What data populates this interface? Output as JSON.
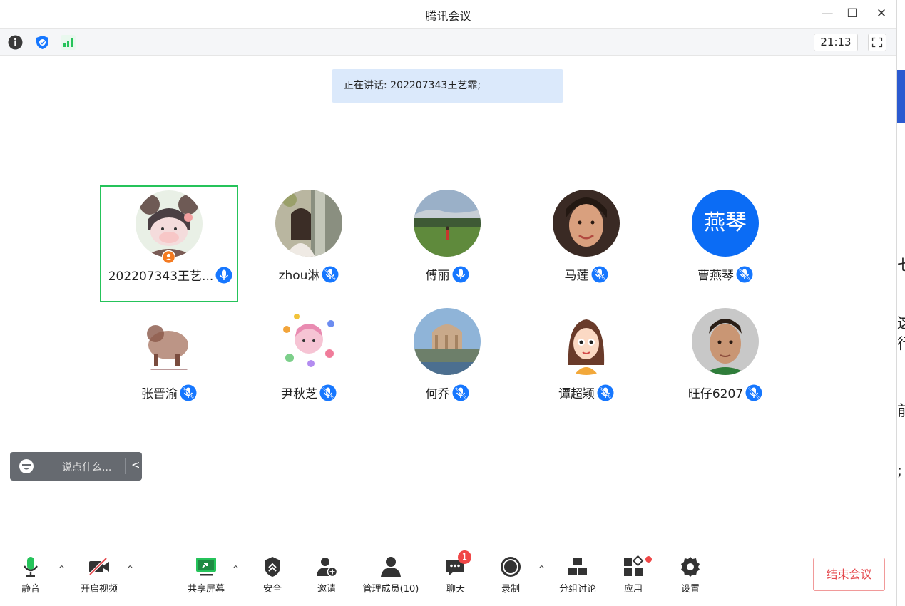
{
  "window": {
    "title": "腾讯会议",
    "minimize": "—",
    "maximize": "☐",
    "close": "✕"
  },
  "status_bar": {
    "clock": "21:13",
    "icons": [
      "info-icon",
      "shield-icon",
      "signal-icon",
      "fullscreen-icon"
    ]
  },
  "banner": {
    "speaking_label": "正在讲话: 202207343王艺霏;"
  },
  "participants": [
    {
      "name": "202207343王艺...",
      "avatar": "cartoon-avatar",
      "mic": "active",
      "host": true,
      "active_speaker": true
    },
    {
      "name": "zhou淋",
      "avatar": "photo-avatar",
      "mic": "muted"
    },
    {
      "name": "傅丽",
      "avatar": "photo-avatar",
      "mic": "active"
    },
    {
      "name": "马莲",
      "avatar": "photo-avatar",
      "mic": "muted"
    },
    {
      "name": "曹燕琴",
      "avatar": "text-avatar",
      "avatar_text": "燕琴",
      "mic": "muted"
    },
    {
      "name": "张晋渝",
      "avatar": "sketch-avatar",
      "mic": "muted"
    },
    {
      "name": "尹秋芝",
      "avatar": "cartoon-avatar",
      "mic": "muted"
    },
    {
      "name": "何乔",
      "avatar": "photo-avatar",
      "mic": "muted"
    },
    {
      "name": "谭超颖",
      "avatar": "cartoon-avatar",
      "mic": "muted"
    },
    {
      "name": "旺仔6207",
      "avatar": "photo-avatar",
      "mic": "muted"
    }
  ],
  "chat_input": {
    "placeholder": "说点什么...",
    "collapse": "<"
  },
  "toolbar": {
    "mute": "静音",
    "video": "开启视频",
    "share": "共享屏幕",
    "security": "安全",
    "invite": "邀请",
    "manage": "管理成员(10)",
    "chat": "聊天",
    "chat_badge": "1",
    "record": "录制",
    "breakout": "分组讨论",
    "apps": "应用",
    "settings": "设置",
    "end": "结束会议",
    "caret": "^"
  },
  "colors": {
    "accent_green": "#25c35a",
    "mic_blue": "#1677ff",
    "end_red": "#e5484d",
    "banner_bg": "#dbe9fb"
  },
  "background_window": {
    "fragments": [
      "七",
      "这",
      "行",
      "前",
      ";"
    ]
  }
}
